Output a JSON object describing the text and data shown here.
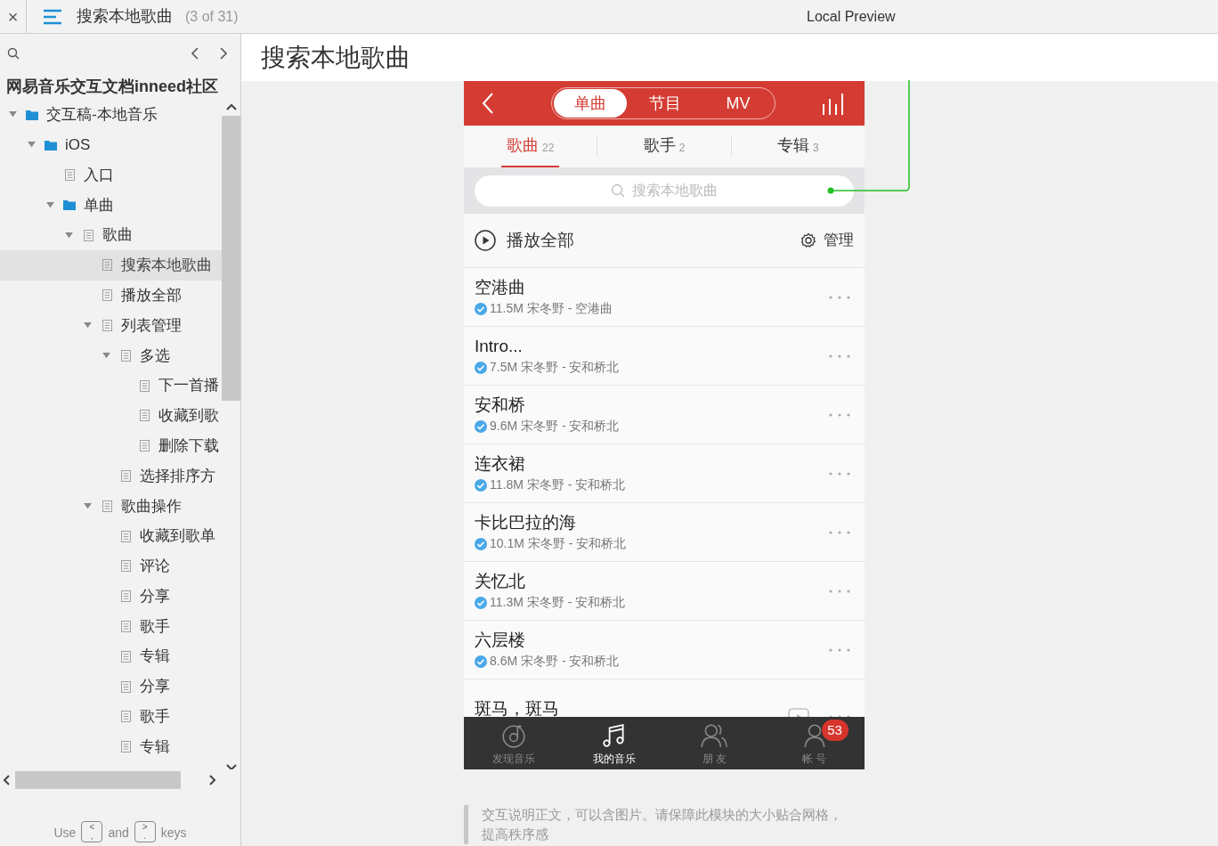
{
  "top_bar": {
    "close": "×",
    "title": "搜索本地歌曲",
    "counter": "(3 of 31)",
    "preview_label": "Local Preview"
  },
  "sidebar": {
    "project_title": "网易音乐交互文档inneed社区",
    "tree": [
      {
        "label": "交互稿-本地音乐",
        "kind": "folder",
        "expanded": true,
        "selected": false,
        "children": [
          {
            "label": "iOS",
            "kind": "folder",
            "expanded": true,
            "selected": false,
            "children": [
              {
                "label": "入口",
                "kind": "page",
                "selected": false
              },
              {
                "label": "单曲",
                "kind": "folder",
                "expanded": true,
                "selected": false,
                "children": [
                  {
                    "label": "歌曲",
                    "kind": "page",
                    "expanded": true,
                    "selected": false,
                    "children": [
                      {
                        "label": "搜索本地歌曲",
                        "kind": "page",
                        "selected": true
                      },
                      {
                        "label": "播放全部",
                        "kind": "page",
                        "selected": false
                      },
                      {
                        "label": "列表管理",
                        "kind": "page",
                        "expanded": true,
                        "selected": false,
                        "children": [
                          {
                            "label": "多选",
                            "kind": "page",
                            "expanded": true,
                            "selected": false,
                            "children": [
                              {
                                "label": "下一首播",
                                "kind": "page",
                                "selected": false
                              },
                              {
                                "label": "收藏到歌",
                                "kind": "page",
                                "selected": false
                              },
                              {
                                "label": "删除下载",
                                "kind": "page",
                                "selected": false
                              }
                            ]
                          },
                          {
                            "label": "选择排序方",
                            "kind": "page",
                            "selected": false
                          }
                        ]
                      },
                      {
                        "label": "歌曲操作",
                        "kind": "page",
                        "expanded": true,
                        "selected": false,
                        "children": [
                          {
                            "label": "收藏到歌单",
                            "kind": "page",
                            "selected": false
                          },
                          {
                            "label": "评论",
                            "kind": "page",
                            "selected": false
                          },
                          {
                            "label": "分享",
                            "kind": "page",
                            "selected": false
                          },
                          {
                            "label": "歌手",
                            "kind": "page",
                            "selected": false
                          },
                          {
                            "label": "专辑",
                            "kind": "page",
                            "selected": false
                          },
                          {
                            "label": "分享",
                            "kind": "page",
                            "selected": false
                          },
                          {
                            "label": "歌手",
                            "kind": "page",
                            "selected": false
                          },
                          {
                            "label": "专辑",
                            "kind": "page",
                            "selected": false
                          }
                        ]
                      }
                    ]
                  }
                ]
              }
            ]
          }
        ]
      }
    ],
    "footer": {
      "use": "Use",
      "and": "and",
      "keys_word": "keys",
      "keys": [
        {
          "top": "<",
          "bottom": ","
        },
        {
          "top": ">",
          "bottom": "."
        }
      ]
    }
  },
  "page": {
    "title": "搜索本地歌曲",
    "phone": {
      "segments": [
        {
          "label": "单曲",
          "selected": true
        },
        {
          "label": "节目",
          "selected": false
        },
        {
          "label": "MV",
          "selected": false
        }
      ],
      "subtabs": [
        {
          "label": "歌曲",
          "count": "22",
          "selected": true
        },
        {
          "label": "歌手",
          "count": "2",
          "selected": false
        },
        {
          "label": "专辑",
          "count": "3",
          "selected": false
        }
      ],
      "search": {
        "placeholder": "搜索本地歌曲"
      },
      "play_all": "播放全部",
      "manage": "管理",
      "songs": [
        {
          "title": "空港曲",
          "meta": "11.5M 宋冬野 - 空港曲",
          "downloaded": true,
          "has_mv": false
        },
        {
          "title": "Intro...",
          "meta": "7.5M 宋冬野 - 安和桥北",
          "downloaded": true,
          "has_mv": false
        },
        {
          "title": "安和桥",
          "meta": "9.6M 宋冬野 - 安和桥北",
          "downloaded": true,
          "has_mv": false
        },
        {
          "title": "连衣裙",
          "meta": "11.8M 宋冬野 - 安和桥北",
          "downloaded": true,
          "has_mv": false
        },
        {
          "title": "卡比巴拉的海",
          "meta": "10.1M 宋冬野 - 安和桥北",
          "downloaded": true,
          "has_mv": false
        },
        {
          "title": "关忆北",
          "meta": "11.3M 宋冬野 - 安和桥北",
          "downloaded": true,
          "has_mv": false
        },
        {
          "title": "六层楼",
          "meta": "8.6M 宋冬野 - 安和桥北",
          "downloaded": true,
          "has_mv": false
        },
        {
          "title": "斑马，斑马",
          "has_mv": true
        }
      ],
      "nav": [
        {
          "label": "发现音乐",
          "kind": "discover",
          "selected": false
        },
        {
          "label": "我的音乐",
          "kind": "music",
          "selected": true
        },
        {
          "label": "朋 友",
          "kind": "friends",
          "selected": false
        },
        {
          "label": "帐 号",
          "kind": "account",
          "selected": false,
          "badge": "53"
        }
      ]
    },
    "note": "交互说明正文，可以含图片。请保障此模块的大小贴合网格，提高秩序感"
  }
}
